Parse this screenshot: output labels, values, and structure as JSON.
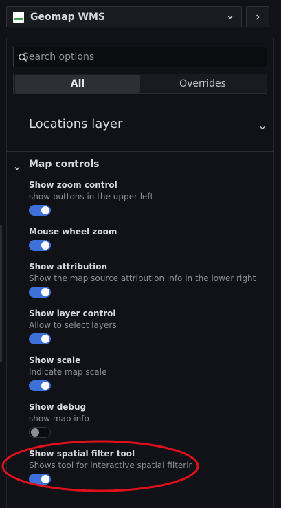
{
  "visualization": {
    "name": "Geomap WMS",
    "icon": "geomap-logo-icon"
  },
  "search": {
    "placeholder": "Search options",
    "value": ""
  },
  "tabs": [
    {
      "label": "All",
      "active": true
    },
    {
      "label": "Overrides",
      "active": false
    }
  ],
  "sections": {
    "locations_layer": {
      "title": "Locations layer",
      "expanded": false
    },
    "map_controls": {
      "title": "Map controls",
      "expanded": true
    }
  },
  "options": [
    {
      "label": "Show zoom control",
      "description": "show buttons in the upper left",
      "enabled": true
    },
    {
      "label": "Mouse wheel zoom",
      "description": "",
      "enabled": true
    },
    {
      "label": "Show attribution",
      "description": "Show the map source attribution info in the lower right",
      "enabled": true
    },
    {
      "label": "Show layer control",
      "description": "Allow to select layers",
      "enabled": true
    },
    {
      "label": "Show scale",
      "description": "Indicate map scale",
      "enabled": true
    },
    {
      "label": "Show debug",
      "description": "show map info",
      "enabled": false
    },
    {
      "label": "Show spatial filter tool",
      "description": "Shows tool for interactive spatial filtering",
      "enabled": true
    }
  ],
  "colors": {
    "background": "#111217",
    "switch_on": "#3d71d9",
    "annotation": "#e0101b"
  }
}
